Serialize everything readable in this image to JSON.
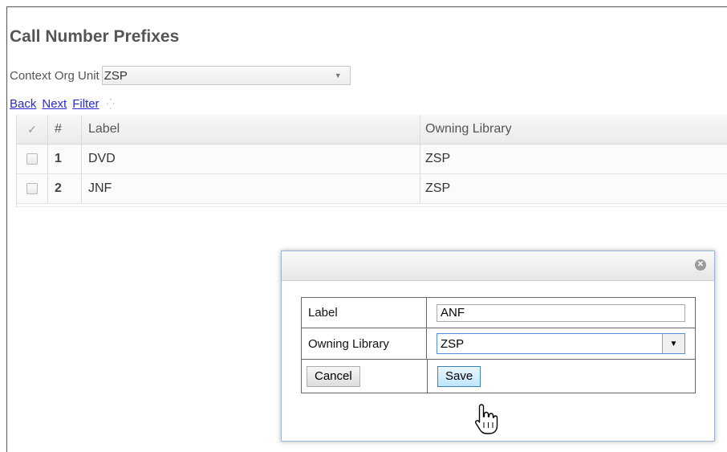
{
  "header": {
    "title": "Call Number Prefixes"
  },
  "context": {
    "label": "Context Org Unit",
    "value": "ZSP"
  },
  "nav": {
    "back": "Back",
    "next": "Next",
    "filter": "Filter"
  },
  "grid": {
    "columns": [
      "✓",
      "#",
      "Label",
      "Owning Library"
    ],
    "rows": [
      {
        "num": "1",
        "label": "DVD",
        "library": "ZSP"
      },
      {
        "num": "2",
        "label": "JNF",
        "library": "ZSP"
      }
    ]
  },
  "dialog": {
    "label_field_label": "Label",
    "label_value": "ANF",
    "library_field_label": "Owning Library",
    "library_value": "ZSP",
    "cancel_label": "Cancel",
    "save_label": "Save"
  },
  "colors": {
    "link": "#2a2ad0",
    "title": "#555555",
    "save_button": "#bee6fd",
    "focus_border": "#4e93d8"
  },
  "icons": [
    "spinner-icon",
    "checkmark-icon",
    "close-icon",
    "chevron-down-icon",
    "hand-cursor-icon"
  ]
}
